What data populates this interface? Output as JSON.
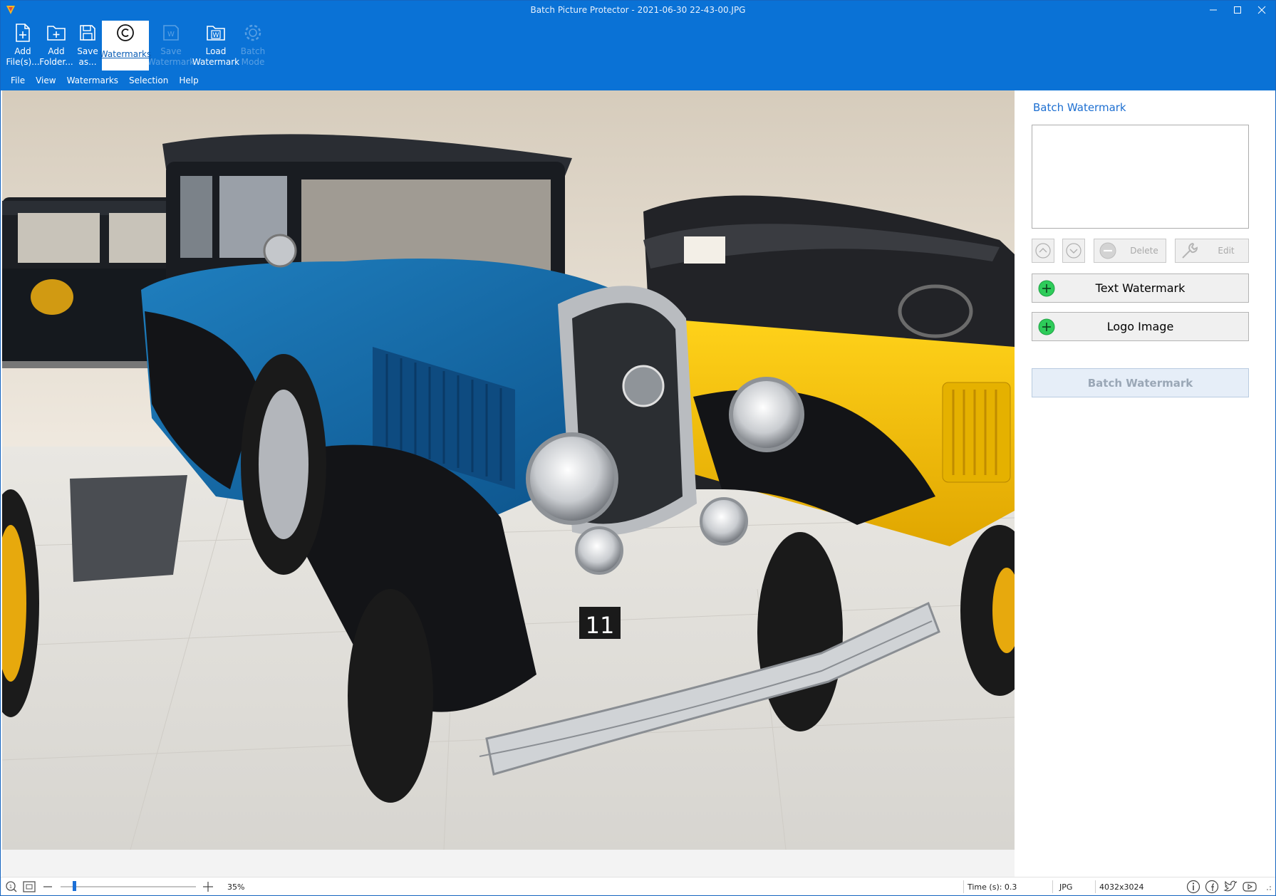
{
  "window": {
    "title": "Batch Picture Protector - 2021-06-30 22-43-00.JPG"
  },
  "toolbar": {
    "add_files": "Add\nFile(s)...",
    "add_folder": "Add\nFolder...",
    "save_as": "Save\nas...",
    "watermarks": "Watermarks",
    "save_watermark": "Save\nWatermark",
    "load_watermark": "Load\nWatermark",
    "batch_mode": "Batch\nMode"
  },
  "menu": [
    "File",
    "View",
    "Watermarks",
    "Selection",
    "Help"
  ],
  "panel": {
    "title": "Batch Watermark",
    "delete_label": "Delete",
    "edit_label": "Edit",
    "text_watermark": "Text Watermark",
    "logo_image": "Logo Image",
    "batch_watermark": "Batch Watermark"
  },
  "statusbar": {
    "zoom": "35%",
    "zoom_level": 0.35,
    "time": "Time (s): 0.3",
    "format": "JPG",
    "dimensions": "4032x3024"
  },
  "colors": {
    "ribbon": "#0a72d6",
    "panel_title": "#1d6fd1",
    "plus_green": "#2ecc5a"
  },
  "icons": {
    "app": "app-icon",
    "add_files": "add-file-icon",
    "add_folder": "add-folder-icon",
    "save": "save-icon",
    "watermarks": "copyright-icon",
    "save_watermark": "save-watermark-icon",
    "load_watermark": "load-watermark-icon",
    "batch_mode": "gear-icon"
  }
}
